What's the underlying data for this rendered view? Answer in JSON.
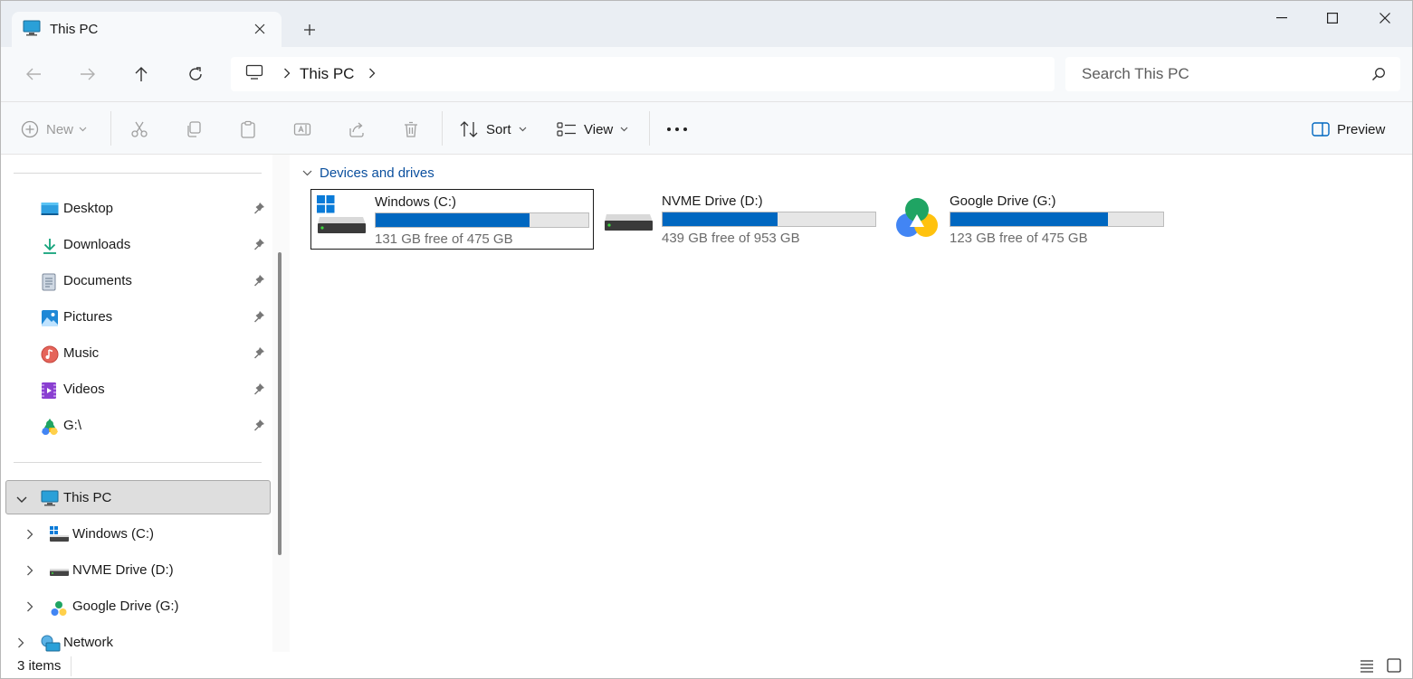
{
  "window": {
    "tab_title": "This PC",
    "accent": "#0067c0"
  },
  "address": {
    "crumbs": [
      "This PC"
    ],
    "search_placeholder": "Search This PC"
  },
  "commandbar": {
    "new_label": "New",
    "sort_label": "Sort",
    "view_label": "View",
    "preview_label": "Preview"
  },
  "sidebar": {
    "quick_access": [
      {
        "label": "Desktop",
        "icon": "desktop-icon"
      },
      {
        "label": "Downloads",
        "icon": "download-icon"
      },
      {
        "label": "Documents",
        "icon": "document-icon"
      },
      {
        "label": "Pictures",
        "icon": "pictures-icon"
      },
      {
        "label": "Music",
        "icon": "music-icon"
      },
      {
        "label": "Videos",
        "icon": "videos-icon"
      },
      {
        "label": "G:\\",
        "icon": "google-drive-icon"
      }
    ],
    "this_pc": {
      "label": "This PC",
      "icon": "monitor-icon"
    },
    "drives": [
      {
        "label": "Windows (C:)",
        "icon": "windows-drive-icon"
      },
      {
        "label": "NVME Drive (D:)",
        "icon": "drive-icon"
      },
      {
        "label": "Google Drive (G:)",
        "icon": "google-drive-icon"
      }
    ],
    "network": {
      "label": "Network",
      "icon": "network-icon"
    }
  },
  "main": {
    "group_label": "Devices and drives",
    "drives": [
      {
        "name": "Windows (C:)",
        "free_text": "131 GB free of 475 GB",
        "used_fraction": 0.724,
        "icon": "windows-drive-icon"
      },
      {
        "name": "NVME Drive (D:)",
        "free_text": "439 GB free of 953 GB",
        "used_fraction": 0.539,
        "icon": "drive-icon"
      },
      {
        "name": "Google Drive (G:)",
        "free_text": "123 GB free of 475 GB",
        "used_fraction": 0.741,
        "icon": "google-drive-icon"
      }
    ]
  },
  "status": {
    "item_count": "3 items"
  }
}
